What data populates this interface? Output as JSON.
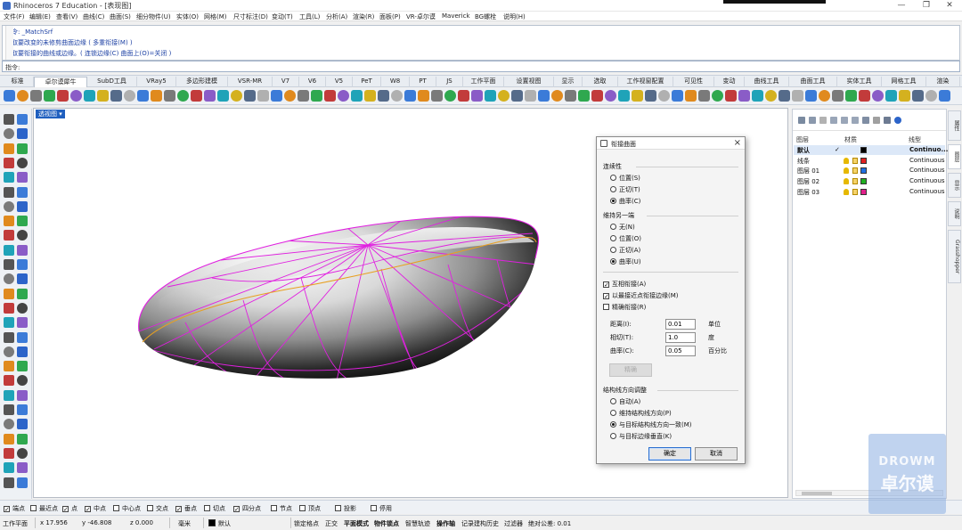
{
  "window": {
    "title": "Rhinoceros 7 Education - [表现图]",
    "controls": {
      "minimize": "—",
      "maximize": "❐",
      "close": "✕"
    }
  },
  "menu": [
    "文件(F)",
    "编辑(E)",
    "查看(V)",
    "曲线(C)",
    "曲面(S)",
    "细分物件(U)",
    "实体(O)",
    "网格(M)",
    "尺寸标注(D)",
    "变动(T)",
    "工具(L)",
    "分析(A)",
    "渲染(R)",
    "面板(P)",
    "VR-卓尔谟",
    "Maverick",
    "BG螺栓",
    "说明(H)"
  ],
  "command": {
    "history": [
      "指令: _MatchSrf",
      "选取要改变的未修剪曲面边缘 ( 多重衔接(M) )",
      "选取要衔接的曲线或边缘。( 连锁边缘(C)  曲面上(O)=关闭 )"
    ],
    "prompt_label": "指令:",
    "input_value": ""
  },
  "tabs": [
    {
      "label": "标准"
    },
    {
      "label": "卓尔谟犀牛"
    },
    {
      "label": "SubD工具"
    },
    {
      "label": "VRay5"
    },
    {
      "label": "多边形建模"
    },
    {
      "label": "VSR-MR"
    },
    {
      "label": "V7"
    },
    {
      "label": "V6"
    },
    {
      "label": "V5"
    },
    {
      "label": "PeT"
    },
    {
      "label": "W8"
    },
    {
      "label": "PT"
    },
    {
      "label": "JS"
    },
    {
      "label": "工作平面"
    },
    {
      "label": "设置视图"
    },
    {
      "label": "显示"
    },
    {
      "label": "选取"
    },
    {
      "label": "工作视窗配置"
    },
    {
      "label": "可见性"
    },
    {
      "label": "变动"
    },
    {
      "label": "曲线工具"
    },
    {
      "label": "曲面工具"
    },
    {
      "label": "实体工具"
    },
    {
      "label": "网格工具"
    },
    {
      "label": "渲染"
    }
  ],
  "active_tab": "卓尔谟犀牛",
  "viewport": {
    "label": "透视图",
    "menu_arrow": "▾"
  },
  "dialog": {
    "title": "衔接曲面",
    "close": "×",
    "continuity_label": "连续性",
    "continuity_options": [
      "位置(S)",
      "正切(T)",
      "曲率(C)"
    ],
    "continuity_selected": 2,
    "keep_label": "维持另一端",
    "keep_options": [
      "无(N)",
      "位置(O)",
      "正切(A)",
      "曲率(U)"
    ],
    "keep_selected": 3,
    "checks": [
      {
        "label": "互相衔接(A)",
        "checked": true
      },
      {
        "label": "以最接近点衔接边缘(M)",
        "checked": true
      },
      {
        "label": "精确衔接(R)",
        "checked": false
      }
    ],
    "tolerances": [
      {
        "label": "距离(I):",
        "value": "0.01",
        "unit": "单位"
      },
      {
        "label": "相切(T):",
        "value": "1.0",
        "unit": "度"
      },
      {
        "label": "曲率(C):",
        "value": "0.05",
        "unit": "百分比"
      }
    ],
    "refine_button": "精确",
    "isocurve_label": "结构线方向调整",
    "isocurve_options": [
      "自动(A)",
      "维持结构线方向(P)",
      "与目标结构线方向一致(M)",
      "与目标边缘垂直(K)"
    ],
    "isocurve_selected": 2,
    "ok": "确定",
    "cancel": "取消"
  },
  "layers": {
    "headers": {
      "layer": "图层",
      "material": "材质",
      "linetype": "线型"
    },
    "rows": [
      {
        "name": "默认",
        "current": "✓",
        "color": "#000000",
        "linetype": "Continuo...",
        "selected": true
      },
      {
        "name": "线条",
        "current": "",
        "color": "#e02020",
        "linetype": "Continuous",
        "selected": false
      },
      {
        "name": "图层 01",
        "current": "",
        "color": "#1f6fe0",
        "linetype": "Continuous",
        "selected": false
      },
      {
        "name": "图层 02",
        "current": "",
        "color": "#20b020",
        "linetype": "Continuous",
        "selected": false
      },
      {
        "name": "图层 03",
        "current": "",
        "color": "#e0208a",
        "linetype": "Continuous",
        "selected": false
      }
    ]
  },
  "side_tabs": [
    "属性",
    "图层",
    "显示",
    "说明",
    "Grasshopper"
  ],
  "osnaps": [
    {
      "label": "端点",
      "on": true
    },
    {
      "label": "最近点",
      "on": false
    },
    {
      "label": "点",
      "on": true
    },
    {
      "label": "中点",
      "on": true
    },
    {
      "label": "中心点",
      "on": false
    },
    {
      "label": "交点",
      "on": false
    },
    {
      "label": "垂点",
      "on": true
    },
    {
      "label": "切点",
      "on": false
    },
    {
      "label": "四分点",
      "on": true
    },
    {
      "label": "节点",
      "on": false
    },
    {
      "label": "顶点",
      "on": false
    },
    {
      "label": "投影",
      "on": false
    },
    {
      "label": "停用",
      "on": false
    }
  ],
  "status": {
    "cplane": "工作平面",
    "x": "x 17.956",
    "y": "y -46.808",
    "z": "z 0.000",
    "unit": "毫米",
    "layer": "默认",
    "toggles": [
      "锁定格点",
      "正交",
      "平面模式",
      "物件锁点",
      "智慧轨迹",
      "操作轴",
      "记录建构历史",
      "过滤器"
    ],
    "bold_toggles": [
      "平面模式",
      "物件锁点",
      "操作轴"
    ],
    "tolerance": "绝对公差: 0.01"
  },
  "watermark": {
    "line1": "DROWM",
    "line2": "卓尔谟"
  },
  "colors": {
    "accent": "#1f5fbf",
    "isocurve": "#e020e0",
    "edge": "#e8a020"
  }
}
